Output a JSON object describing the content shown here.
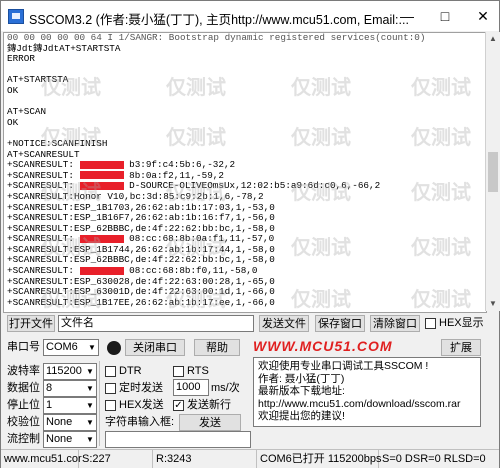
{
  "window": {
    "title": "SSCOM3.2 (作者:聂小猛(丁丁), 主页http://www.mcu51.com, Email:...",
    "min_label": "—",
    "max_label": "□",
    "close_label": "✕"
  },
  "terminal": {
    "lines": [
      "00 00 00 00 00 64 I 1/SANGR: Bootstrap dynamic registered services(count:0)",
      "鏄Jdt鏄JdtAT+STARTSTA",
      "ERROR",
      "",
      "AT+STARTSTA",
      "OK",
      "",
      "AT+SCAN",
      "OK",
      "",
      "+NOTICE:SCANFINISH",
      "AT+SCANRESULT",
      "+SCANRESULT: [R] b3:9f:c4:5b:6,-32,2",
      "+SCANRESULT: [R] 8b:0a:f2,11,-59,2",
      "+SCANRESULT: [R] D-SOURCE-OLIVEOmsUx,12:02:b5:a9:6d:c0,6,-66,2",
      "+SCANRESULT:Honor V10,bc:3d:85:c9:2b:1,6,-78,2",
      "+SCANRESULT:ESP_1B1703,26:62:ab:1b:17:03,1,-53,0",
      "+SCANRESULT:ESP_1B16F7,26:62:ab:1b:16:f7,1,-56,0",
      "+SCANRESULT:ESP_62BBBC,de:4f:22:62:bb:bc,1,-58,0",
      "+SCANRESULT: [R] 08:cc:68:8b:0a:f1,11,-57,0",
      "+SCANRESULT:ESP_1B1744,26:62:ab:1b:17:44,1,-58,0",
      "+SCANRESULT:ESP_62BBBC,de:4f:22:62:bb:bc,1,-58,0",
      "+SCANRESULT: [R] 08:cc:68:8b:f0,11,-58,0",
      "+SCANRESULT:ESP_630028,de:4f:22:63:00:28,1,-65,0",
      "+SCANRESULT:ESP_63001D,de:4f:22:63:00:1d,1,-66,0",
      "+SCANRESULT:ESP_1B17EE,26:62:ab:1b:17:ee,1,-66,0"
    ],
    "watermark_text": "仅测试"
  },
  "row1": {
    "open_file": "打开文件",
    "filename_label": "文件名",
    "send_file": "发送文件",
    "save_window": "保存窗口",
    "clear_window": "清除窗口",
    "hex_display": "HEX显示"
  },
  "row2": {
    "port_label": "串口号",
    "port_value": "COM6",
    "close_port": "关闭串口",
    "help": "帮助",
    "brand": "WWW.MCU51.COM",
    "expand": "扩展"
  },
  "settings": {
    "baud_label": "波特率",
    "baud_value": "115200",
    "databits_label": "数据位",
    "databits_value": "8",
    "stopbits_label": "停止位",
    "stopbits_value": "1",
    "parity_label": "校验位",
    "parity_value": "None",
    "flow_label": "流控制",
    "flow_value": "None"
  },
  "options": {
    "dtr": "DTR",
    "rts": "RTS",
    "timed_send": "定时发送",
    "interval_value": "1000",
    "interval_unit": "ms/次",
    "hex_send": "HEX发送",
    "send_newline": "发送新行",
    "input_label": "字符串输入框:",
    "send": "发送"
  },
  "info": {
    "lines": [
      "欢迎使用专业串口调试工具SSCOM !",
      "作者: 聂小猛(丁丁)",
      "最新版本下载地址:",
      "http://www.mcu51.com/download/sscom.rar",
      "欢迎提出您的建议!"
    ]
  },
  "status": {
    "site": "www.mcu51.cor",
    "sent": "S:227",
    "received": "R:3243",
    "port_state": "COM6已打开  115200bps",
    "signals": "S=0 DSR=0 RLSD=0"
  },
  "colors": {
    "redaction": "#e8202a",
    "brand_red": "#e02020"
  }
}
